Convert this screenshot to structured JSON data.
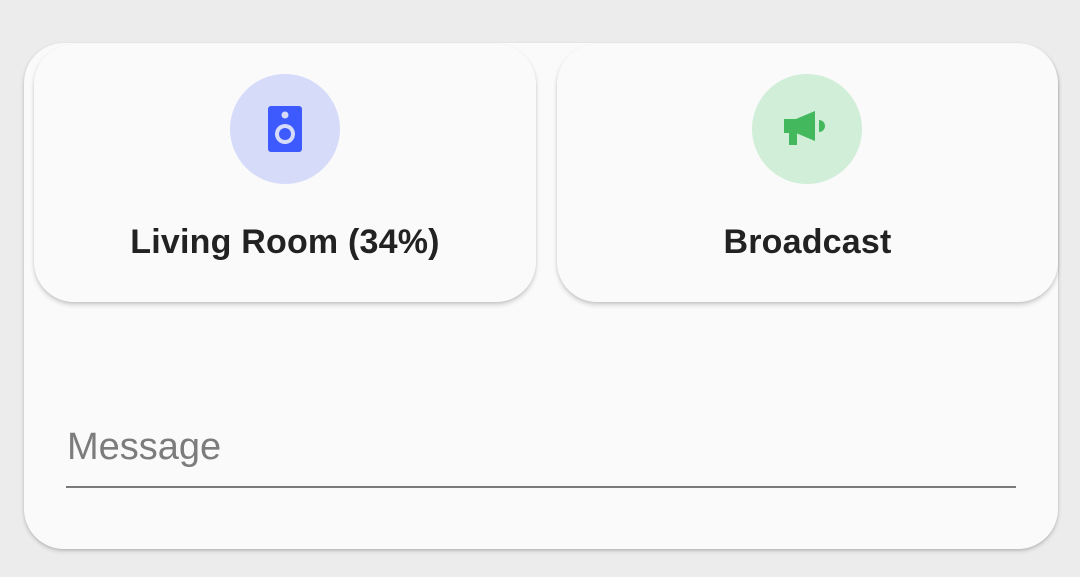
{
  "tiles": [
    {
      "label": "Living Room (34%)",
      "icon": "speaker-icon",
      "icon_color": "#3d5afe",
      "icon_bg": "#d6dbfa"
    },
    {
      "label": "Broadcast",
      "icon": "megaphone-icon",
      "icon_color": "#43b85c",
      "icon_bg": "#d0eed8"
    }
  ],
  "message": {
    "placeholder": "Message",
    "value": ""
  }
}
